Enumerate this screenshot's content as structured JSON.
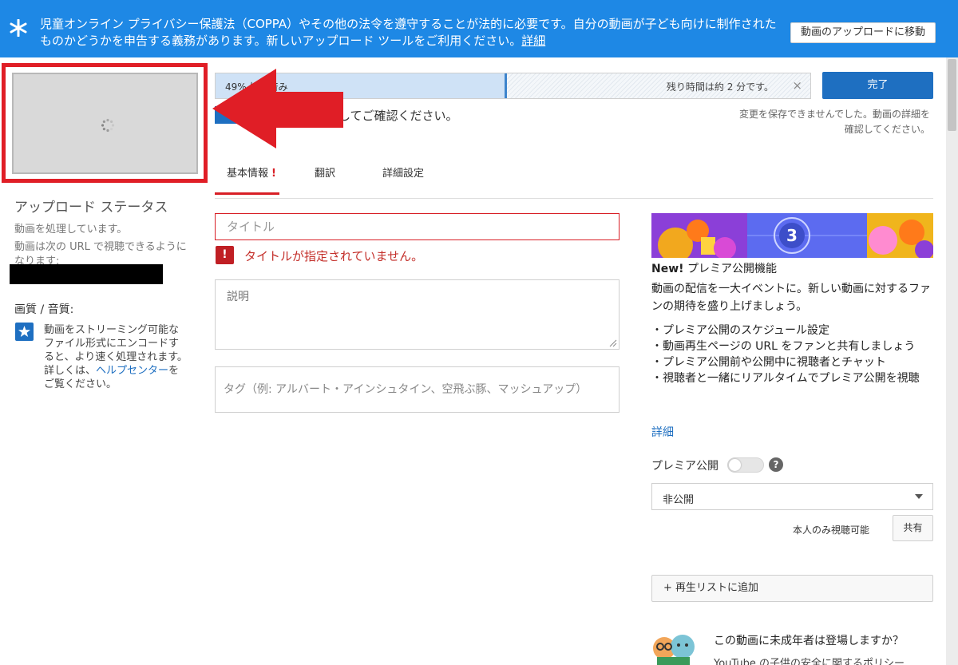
{
  "banner": {
    "text": "児童オンライン プライバシー保護法（COPPA）やその他の法令を遵守することが法的に必要です。自分の動画が子ども向けに制作されたものかどうかを申告する義務があります。新しいアップロード ツールをご利用ください。",
    "link": "詳細",
    "button": "動画のアップロードに移動"
  },
  "left": {
    "status_title": "アップロード ステータス",
    "status_text": "動画を処理しています。",
    "status_url": "動画は次の URL で視聴できるようになります:",
    "quality_title": "画質 / 音質:",
    "quality_text": "動画をストリーミング可能なファイル形式にエンコードすると、より速く処理されます。詳しくは、",
    "help_link": "ヘルプセンター",
    "quality_suffix": "をご覧ください。"
  },
  "progress": {
    "label": "49% 処理済み",
    "fraction": 0.49,
    "remaining": "残り時間は約 2 分です。",
    "close": "×",
    "done_button": "完了",
    "save_error": "変更を保存できませんでした。動画の詳細を確認してください。"
  },
  "notice": {
    "text": "してご確認ください。"
  },
  "tabs": [
    {
      "label": "基本情報",
      "badge": "!"
    },
    {
      "label": "翻訳"
    },
    {
      "label": "詳細設定"
    }
  ],
  "form": {
    "title_placeholder": "タイトル",
    "title_error_icon": "!",
    "title_error": "タイトルが指定されていません。",
    "description_placeholder": "説明",
    "tags_placeholder": "タグ（例: アルバート・アインシュタイン、空飛ぶ豚、マッシュアップ）"
  },
  "promo": {
    "countdown": "3",
    "title_new": "New!",
    "title_rest": " プレミア公開機能",
    "body": "動画の配信を一大イベントに。新しい動画に対するファンの期待を盛り上げましょう。",
    "items": [
      "・プレミア公開のスケジュール設定",
      "・動画再生ページの URL をファンと共有しましょう",
      "・プレミア公開前や公開中に視聴者とチャット",
      "・視聴者と一緒にリアルタイムでプレミア公開を視聴"
    ],
    "more": "詳細"
  },
  "settings": {
    "premiere_label": "プレミア公開",
    "premiere_on": false,
    "help": "?",
    "privacy_value": "非公開",
    "private_note": "本人のみ視聴可能",
    "share_button": "共有",
    "playlist_button": "+ 再生リストに追加"
  },
  "kids": {
    "question": "この動画に未成年者は登場しますか？",
    "sub": "YouTube の子供の安全に関するポリシー"
  },
  "colors": {
    "banner_blue": "#1e88e5",
    "primary_blue": "#1e6fc1",
    "error_red": "#d81f26",
    "arrow_red": "#e01e26"
  },
  "icons": {
    "banner": "star-icon",
    "quality": "star-icon",
    "thumbnail": "loading-spinner-icon",
    "close": "close-icon",
    "error": "exclamation-icon",
    "dropdown": "caret-down-icon",
    "help": "question-icon"
  }
}
